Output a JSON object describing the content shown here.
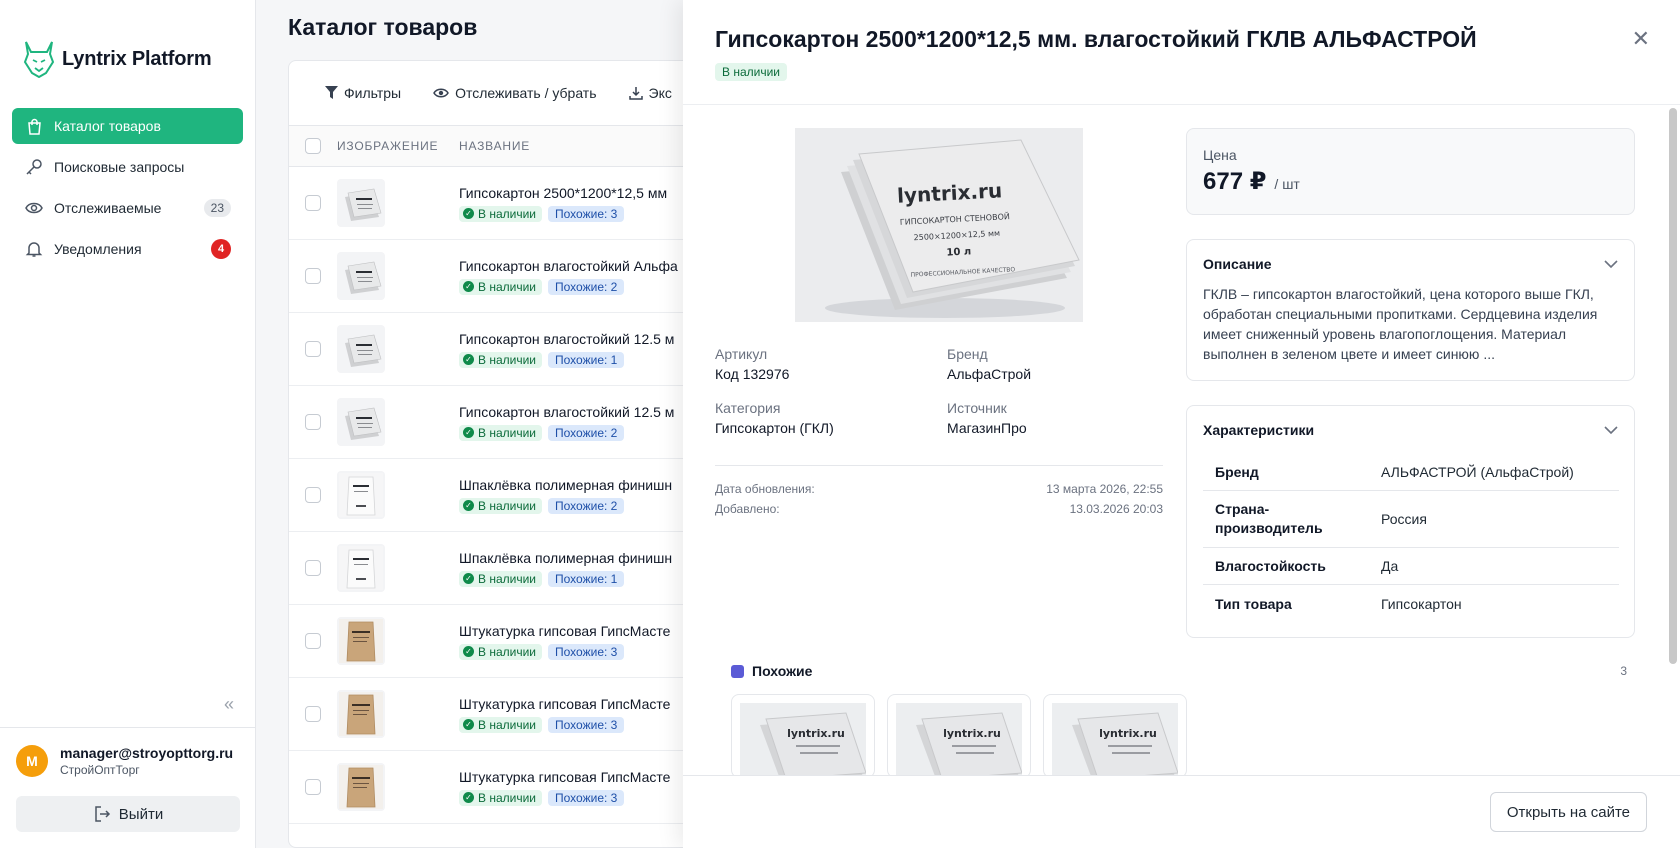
{
  "app": {
    "name": "Lyntrix Platform"
  },
  "sidebar": {
    "items": [
      {
        "label": "Каталог товаров"
      },
      {
        "label": "Поисковые запросы"
      },
      {
        "label": "Отслеживаемые",
        "badge": "23"
      },
      {
        "label": "Уведомления",
        "badge": "4"
      }
    ],
    "user": {
      "avatar_letter": "M",
      "email": "manager@stroyopttorg.ru",
      "org": "СтройОптТорг"
    },
    "logout_label": "Выйти"
  },
  "main": {
    "title": "Каталог товаров",
    "toolbar": {
      "filters": "Фильтры",
      "track": "Отслеживать / убрать",
      "export": "Экс"
    },
    "columns": {
      "image": "ИЗОБРАЖЕНИЕ",
      "name": "НАЗВАНИЕ"
    },
    "rows": [
      {
        "name": "Гипсокартон 2500*1200*12,5 мм",
        "status": "В наличии",
        "similar": "Похожие: 3",
        "thumb": "board"
      },
      {
        "name": "Гипсокартон влагостойкий Альфа",
        "status": "В наличии",
        "similar": "Похожие: 2",
        "thumb": "board"
      },
      {
        "name": "Гипсокартон влагостойкий 12.5 м",
        "status": "В наличии",
        "similar": "Похожие: 1",
        "thumb": "board"
      },
      {
        "name": "Гипсокартон влагостойкий 12.5 м",
        "status": "В наличии",
        "similar": "Похожие: 2",
        "thumb": "board"
      },
      {
        "name": "Шпаклёвка полимерная финишн",
        "status": "В наличии",
        "similar": "Похожие: 2",
        "thumb": "white-bag"
      },
      {
        "name": "Шпаклёвка полимерная финишн",
        "status": "В наличии",
        "similar": "Похожие: 1",
        "thumb": "white-bag"
      },
      {
        "name": "Штукатурка гипсовая ГипсМасте",
        "status": "В наличии",
        "similar": "Похожие: 3",
        "thumb": "paper-bag"
      },
      {
        "name": "Штукатурка гипсовая ГипсМасте",
        "status": "В наличии",
        "similar": "Похожие: 3",
        "thumb": "paper-bag"
      },
      {
        "name": "Штукатурка гипсовая ГипсМасте",
        "status": "В наличии",
        "similar": "Похожие: 3",
        "thumb": "paper-bag"
      }
    ]
  },
  "drawer": {
    "title": "Гипсокартон 2500*1200*12,5 мм. влагостойкий ГКЛВ АЛЬФАСТРОЙ",
    "status": "В наличии",
    "image": {
      "brand": "lyntrix.ru",
      "line1": "ГИПСОКАРТОН СТЕНОВОЙ",
      "line2": "2500×1200×12,5 мм",
      "line3": "10 л",
      "line4": "ПРОФЕССИОНАЛЬНОЕ КАЧЕСТВО"
    },
    "meta": {
      "article_label": "Артикул",
      "article_value": "Код  132976",
      "brand_label": "Бренд",
      "brand_value": "АльфаСтрой",
      "category_label": "Категория",
      "category_value": "Гипсокартон (ГКЛ)",
      "source_label": "Источник",
      "source_value": "МагазинПро"
    },
    "dates": {
      "updated_label": "Дата обновления:",
      "updated_value": "13 марта 2026, 22:55",
      "added_label": "Добавлено:",
      "added_value": "13.03.2026 20:03"
    },
    "price": {
      "label": "Цена",
      "value": "677 ₽",
      "unit": "/ шт"
    },
    "description": {
      "title": "Описание",
      "text": "ГКЛВ – гипсокартон влагостойкий, цена которого выше ГКЛ, обработан специальными пропитками. Сердцевина изделия имеет сниженный уровень влагопоглощения. Материал выполнен в зеленом цвете и имеет синюю ..."
    },
    "specs": {
      "title": "Характеристики",
      "rows": [
        {
          "key": "Бренд",
          "value": "АЛЬФАСТРОЙ (АльфаСтрой)"
        },
        {
          "key": "Страна-производитель",
          "value": "Россия"
        },
        {
          "key": "Влагостойкость",
          "value": "Да"
        },
        {
          "key": "Тип товара",
          "value": "Гипсокартон"
        }
      ]
    },
    "similar": {
      "title": "Похожие",
      "count": "3",
      "card_brand": "lyntrix.ru"
    },
    "open_button": "Открыть на сайте"
  },
  "colors": {
    "accent": "#1fb57f",
    "danger": "#e02424",
    "in_stock_bg": "#e3f6ec",
    "similar_bg": "#dbe8fb"
  }
}
